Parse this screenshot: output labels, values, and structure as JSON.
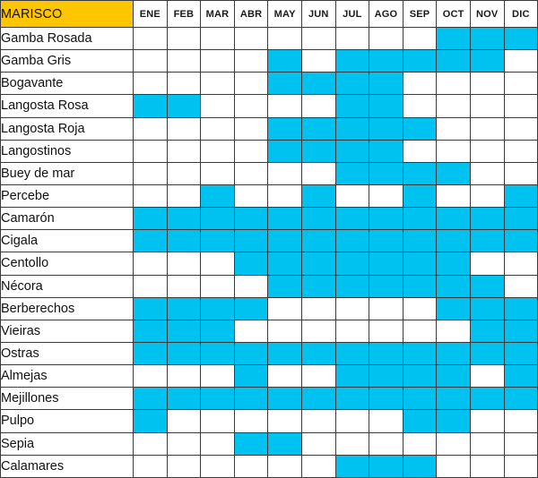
{
  "table": {
    "corner_header": "MARISCO",
    "months": [
      "ENE",
      "FEB",
      "MAR",
      "ABR",
      "MAY",
      "JUN",
      "JUL",
      "AGO",
      "SEP",
      "OCT",
      "NOV",
      "DIC"
    ],
    "colors": {
      "header_background": "#FFC600",
      "in_season_fill": "#00C2F0",
      "out_of_season_fill": "#FFFFFF",
      "grid_line": "#3A3A3A",
      "text": "#111111"
    },
    "legend": {
      "in_season_meaning": "temporada (celda azul)",
      "out_of_season_meaning": "fuera de temporada (celda blanca)"
    },
    "rows": [
      {
        "name": "Gamba Rosada",
        "season": [
          0,
          0,
          0,
          0,
          0,
          0,
          0,
          0,
          0,
          1,
          1,
          1
        ]
      },
      {
        "name": "Gamba Gris",
        "season": [
          0,
          0,
          0,
          0,
          1,
          0,
          1,
          1,
          1,
          1,
          1,
          0
        ]
      },
      {
        "name": "Bogavante",
        "season": [
          0,
          0,
          0,
          0,
          1,
          1,
          1,
          1,
          0,
          0,
          0,
          0
        ]
      },
      {
        "name": "Langosta Rosa",
        "season": [
          1,
          1,
          0,
          0,
          0,
          0,
          1,
          1,
          0,
          0,
          0,
          0
        ]
      },
      {
        "name": "Langosta Roja",
        "season": [
          0,
          0,
          0,
          0,
          1,
          1,
          1,
          1,
          1,
          0,
          0,
          0
        ]
      },
      {
        "name": "Langostinos",
        "season": [
          0,
          0,
          0,
          0,
          1,
          1,
          1,
          1,
          0,
          0,
          0,
          0
        ]
      },
      {
        "name": "Buey de mar",
        "season": [
          0,
          0,
          0,
          0,
          0,
          0,
          1,
          1,
          1,
          1,
          0,
          0
        ]
      },
      {
        "name": "Percebe",
        "season": [
          0,
          0,
          1,
          0,
          0,
          1,
          0,
          0,
          1,
          0,
          0,
          1
        ]
      },
      {
        "name": "Camarón",
        "season": [
          1,
          1,
          1,
          1,
          1,
          1,
          1,
          1,
          1,
          1,
          1,
          1
        ]
      },
      {
        "name": "Cigala",
        "season": [
          1,
          1,
          1,
          1,
          1,
          1,
          1,
          1,
          1,
          1,
          1,
          1
        ]
      },
      {
        "name": "Centollo",
        "season": [
          0,
          0,
          0,
          1,
          1,
          1,
          1,
          1,
          1,
          1,
          0,
          0
        ]
      },
      {
        "name": "Nécora",
        "season": [
          0,
          0,
          0,
          0,
          1,
          1,
          1,
          1,
          1,
          1,
          1,
          0
        ]
      },
      {
        "name": "Berberechos",
        "season": [
          1,
          1,
          1,
          1,
          0,
          0,
          0,
          0,
          0,
          1,
          1,
          1
        ]
      },
      {
        "name": "Vieiras",
        "season": [
          1,
          1,
          1,
          0,
          0,
          0,
          0,
          0,
          0,
          0,
          1,
          1
        ]
      },
      {
        "name": "Ostras",
        "season": [
          1,
          1,
          1,
          1,
          1,
          1,
          1,
          1,
          1,
          1,
          1,
          1
        ]
      },
      {
        "name": "Almejas",
        "season": [
          0,
          0,
          0,
          1,
          0,
          0,
          1,
          1,
          1,
          1,
          0,
          1
        ]
      },
      {
        "name": "Mejillones",
        "season": [
          1,
          1,
          1,
          1,
          1,
          1,
          1,
          1,
          1,
          1,
          1,
          1
        ]
      },
      {
        "name": "Pulpo",
        "season": [
          1,
          0,
          0,
          0,
          0,
          0,
          0,
          0,
          1,
          1,
          0,
          0
        ]
      },
      {
        "name": "Sepia",
        "season": [
          0,
          0,
          0,
          1,
          1,
          0,
          0,
          0,
          0,
          0,
          0,
          0
        ]
      },
      {
        "name": "Calamares",
        "season": [
          0,
          0,
          0,
          0,
          0,
          0,
          1,
          1,
          1,
          0,
          0,
          0
        ]
      }
    ]
  }
}
